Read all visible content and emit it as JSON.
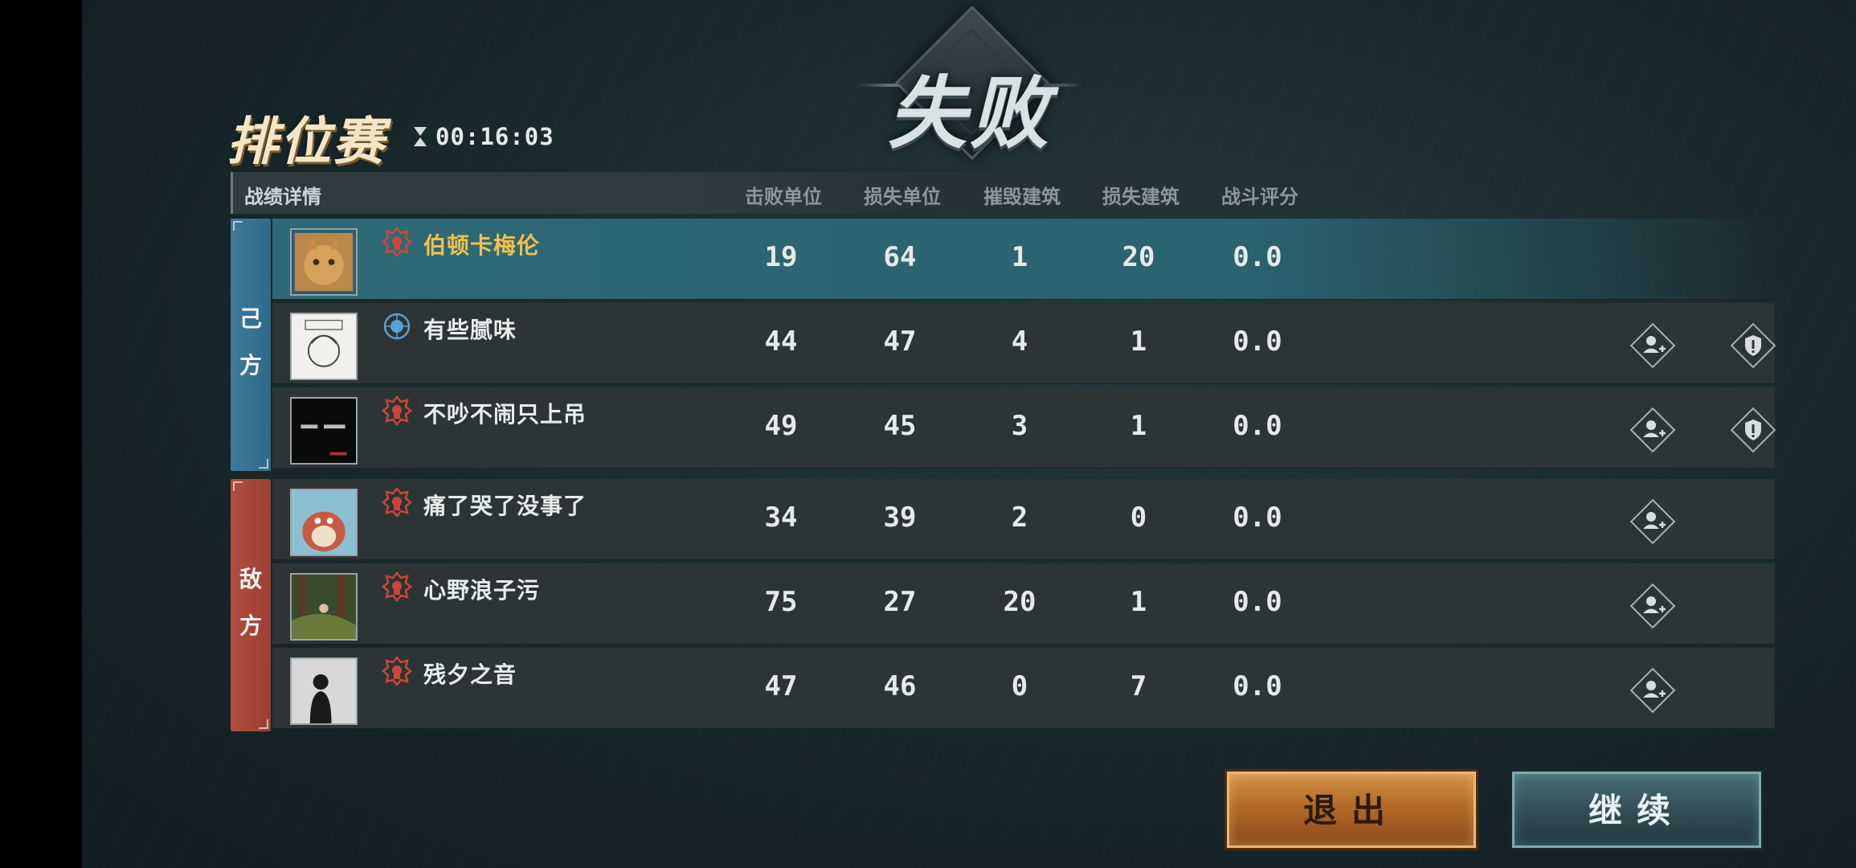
{
  "result_title": "失败",
  "header": {
    "mode": "排位赛",
    "timer": "00:16:03"
  },
  "table": {
    "section_label": "战绩详情",
    "columns": [
      "击败单位",
      "损失单位",
      "摧毁建筑",
      "损失建筑",
      "战斗评分"
    ]
  },
  "teams": {
    "ally_label_1": "己",
    "ally_label_2": "方",
    "enemy_label_1": "敌",
    "enemy_label_2": "方"
  },
  "players": [
    {
      "name": "伯顿卡梅伦",
      "team": "ally",
      "self": true,
      "rank_icon": "red-rank-icon",
      "kills": "19",
      "losses": "64",
      "destroyed": "1",
      "lost_buildings": "20",
      "score": "0.0"
    },
    {
      "name": "有些腻味",
      "team": "ally",
      "self": false,
      "rank_icon": "blue-globe-rank-icon",
      "kills": "44",
      "losses": "47",
      "destroyed": "4",
      "lost_buildings": "1",
      "score": "0.0"
    },
    {
      "name": "不吵不闹只上吊",
      "team": "ally",
      "self": false,
      "rank_icon": "red-rank-icon",
      "kills": "49",
      "losses": "45",
      "destroyed": "3",
      "lost_buildings": "1",
      "score": "0.0"
    },
    {
      "name": "痛了哭了没事了",
      "team": "enemy",
      "self": false,
      "rank_icon": "red-rank-icon",
      "kills": "34",
      "losses": "39",
      "destroyed": "2",
      "lost_buildings": "0",
      "score": "0.0"
    },
    {
      "name": "心野浪子污",
      "team": "enemy",
      "self": false,
      "rank_icon": "red-rank-icon",
      "kills": "75",
      "losses": "27",
      "destroyed": "20",
      "lost_buildings": "1",
      "score": "0.0"
    },
    {
      "name": "残夕之音",
      "team": "enemy",
      "self": false,
      "rank_icon": "red-rank-icon",
      "kills": "47",
      "losses": "46",
      "destroyed": "0",
      "lost_buildings": "7",
      "score": "0.0"
    }
  ],
  "buttons": {
    "exit": "退出",
    "continue": "继续"
  },
  "colors": {
    "ally": "#3f7a9b",
    "enemy": "#b34d3f",
    "self_highlight": "#2e6a76",
    "self_name": "#f2c04a"
  }
}
